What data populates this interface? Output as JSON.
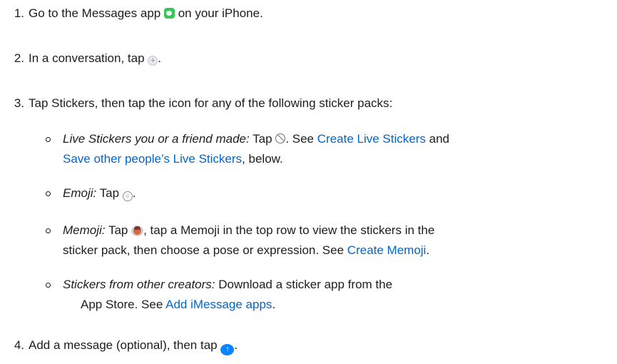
{
  "steps": [
    {
      "number": "1.",
      "before": "Go to the Messages app",
      "after": "on your iPhone."
    },
    {
      "number": "2.",
      "before": "In a conversation, tap",
      "after": "."
    },
    {
      "number": "3.",
      "text": "Tap Stickers, then tap the icon for any of the following sticker packs:"
    },
    {
      "number": "4.",
      "before": "Add a message (optional), then tap",
      "after": "."
    }
  ],
  "sub_items": {
    "live": {
      "term": "Live Stickers you or a friend made:",
      "tap": "Tap",
      "see": ". See",
      "link1": "Create Live Stickers",
      "and": "and",
      "link2": "Save other people’s Live Stickers",
      "tail": ", below."
    },
    "emoji": {
      "term": "Emoji:",
      "tap": "Tap",
      "tail": "."
    },
    "memoji": {
      "term": "Memoji:",
      "tap": "Tap",
      "text1": ", tap a Memoji in the top row to view the stickers in the",
      "text2": "sticker pack, then choose a pose or expression. See",
      "link": "Create Memoji",
      "tail": "."
    },
    "other": {
      "term": "Stickers from other creators:",
      "text1": "Download a sticker app from the",
      "text2": "App Store. See",
      "link": "Add iMessage apps",
      "tail": "."
    }
  },
  "icons": {
    "messages": "messages-app-icon",
    "plus": "plus-button-icon",
    "live": "live-stickers-icon",
    "emoji": "emoji-icon",
    "memoji": "memoji-icon",
    "send": "send-button-icon"
  },
  "colors": {
    "text": "#1d1d1f",
    "link": "#0066cc",
    "messages_green": "#33c759",
    "send_blue": "#0a84ff"
  }
}
